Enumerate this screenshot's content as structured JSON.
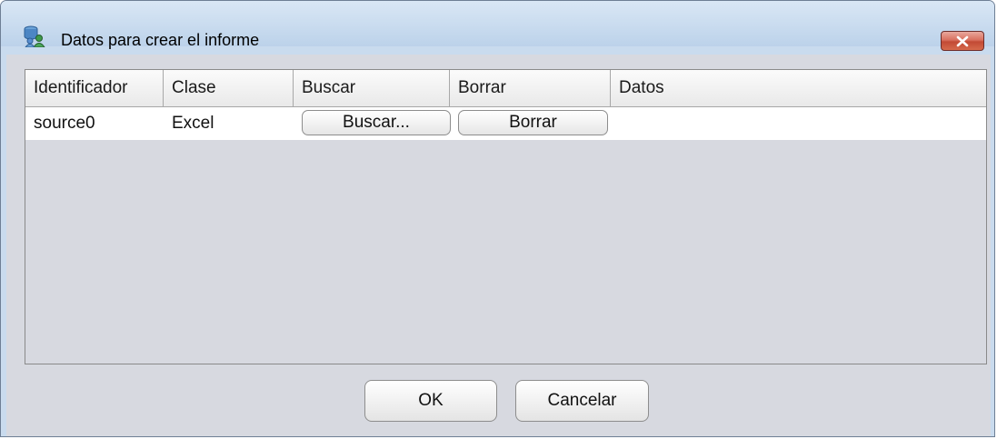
{
  "window": {
    "title": "Datos para crear el informe",
    "icon": "database-users-icon"
  },
  "table": {
    "columns": [
      "Identificador",
      "Clase",
      "Buscar",
      "Borrar",
      "Datos"
    ],
    "rows": [
      {
        "identificador": "source0",
        "clase": "Excel",
        "buscar_button": "Buscar...",
        "borrar_button": "Borrar",
        "datos": ""
      }
    ]
  },
  "buttons": {
    "ok": "OK",
    "cancel": "Cancelar"
  },
  "colors": {
    "title_bar": "#c9dbee",
    "dialog_background": "#d7d9e0",
    "close_button": "#c94f3a"
  }
}
